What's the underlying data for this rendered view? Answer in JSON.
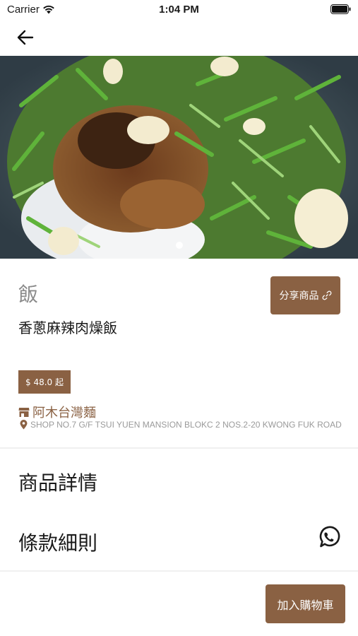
{
  "status_bar": {
    "carrier": "Carrier",
    "time": "1:04 PM"
  },
  "product": {
    "category": "飯",
    "name": "香蔥麻辣肉燥飯",
    "price": "$ 48.0 起",
    "share_label": "分享商品"
  },
  "shop": {
    "name": "阿木台灣麵",
    "address": "SHOP NO.7 G/F TSUI YUEN MANSION BLOKC 2 NOS.2-20 KWONG FUK ROAD"
  },
  "sections": {
    "details": "商品詳情",
    "terms": "條款細則"
  },
  "actions": {
    "add_to_cart": "加入購物車"
  },
  "colors": {
    "accent": "#8a6143",
    "whatsapp_icon": "#1a1a1a"
  }
}
